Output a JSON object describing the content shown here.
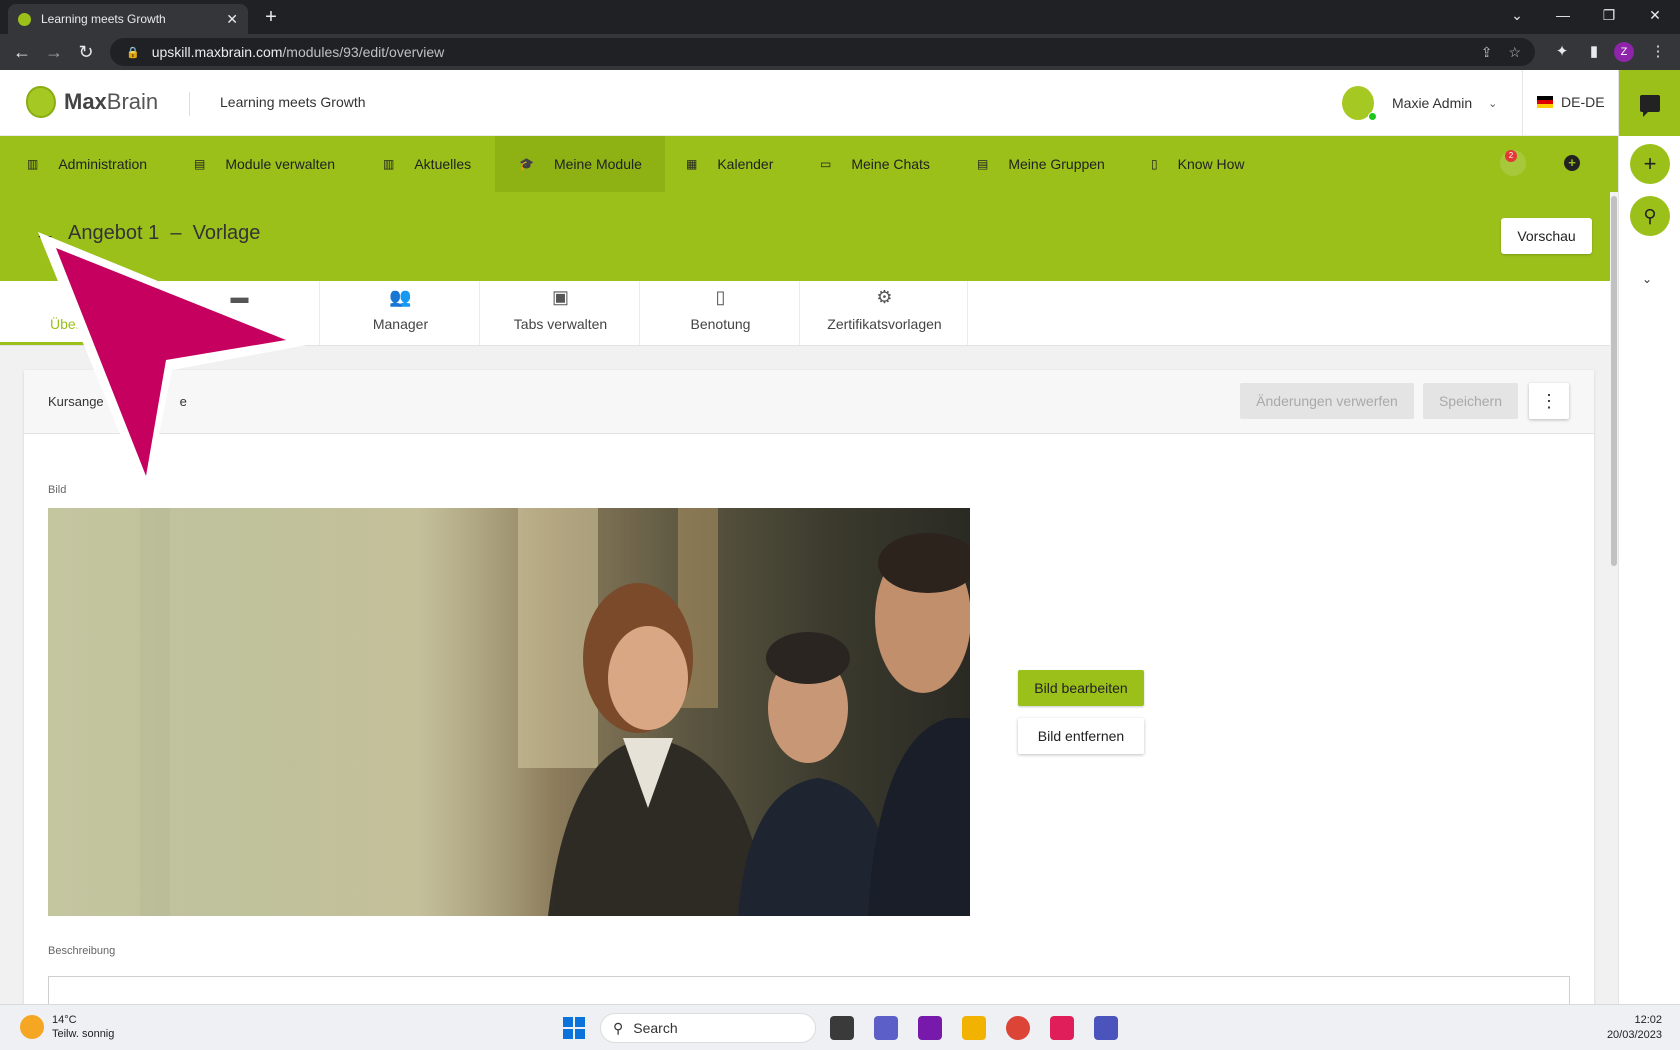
{
  "browser": {
    "tab_title": "Learning meets Growth",
    "tab_close": "✕",
    "new_tab": "+",
    "url_host": "upskill.maxbrain.com",
    "url_path": "/modules/93/edit/overview",
    "profile_initial": "Z"
  },
  "header": {
    "logo_bold": "Max",
    "logo_light": "Brain",
    "tagline": "Learning meets Growth",
    "user_name": "Maxie Admin",
    "language": "DE-DE"
  },
  "nav": {
    "items": [
      {
        "label": "Administration",
        "icon": "admin-icon"
      },
      {
        "label": "Module verwalten",
        "icon": "module-icon"
      },
      {
        "label": "Aktuelles",
        "icon": "news-icon"
      },
      {
        "label": "Meine Module",
        "icon": "graduation-cap-icon"
      },
      {
        "label": "Kalender",
        "icon": "calendar-icon"
      },
      {
        "label": "Meine Chats",
        "icon": "chat-icon"
      },
      {
        "label": "Meine Gruppen",
        "icon": "groups-icon"
      },
      {
        "label": "Know How",
        "icon": "book-icon"
      }
    ],
    "active_index": 3,
    "notification_count": "2"
  },
  "page": {
    "title_main": "Angebot 1",
    "title_sep": "–",
    "title_sub": "Vorlage",
    "preview_label": "Vorschau"
  },
  "tabs": [
    {
      "label": "Übersicht",
      "visible_label": "Über",
      "icon": "overview-icon"
    },
    {
      "label": "",
      "icon": "folder-icon"
    },
    {
      "label": "Manager",
      "icon": "people-icon"
    },
    {
      "label": "Tabs verwalten",
      "icon": "browser-window-icon"
    },
    {
      "label": "Benotung",
      "icon": "grade-document-icon"
    },
    {
      "label": "Zertifikatsvorlagen",
      "icon": "certificate-settings-icon"
    }
  ],
  "card": {
    "title_start": "Kursange",
    "title_end": "e",
    "discard_label": "Änderungen verwerfen",
    "save_label": "Speichern",
    "image_label": "Bild",
    "edit_image_label": "Bild bearbeiten",
    "remove_image_label": "Bild entfernen",
    "description_label": "Beschreibung"
  },
  "taskbar": {
    "temperature": "14°C",
    "weather": "Teilw. sonnig",
    "search_placeholder": "Search",
    "time": "12:02",
    "date": "20/03/2023"
  },
  "colors": {
    "brand_green": "#9bc01a",
    "active_nav": "#8eb214",
    "annotation_arrow": "#c5005e"
  }
}
